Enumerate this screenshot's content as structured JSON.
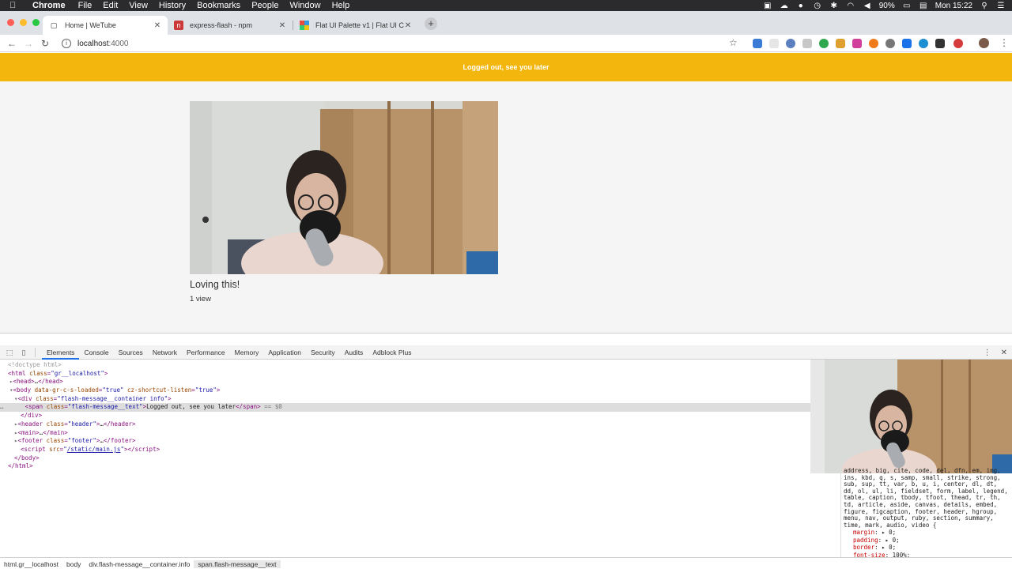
{
  "menubar": {
    "app": "Chrome",
    "menus": [
      "File",
      "Edit",
      "View",
      "History",
      "Bookmarks",
      "People",
      "Window",
      "Help"
    ],
    "battery": "90%",
    "clock": "Mon 15:22"
  },
  "tabs": [
    {
      "title": "Home | WeTube",
      "favicon": "page-icon"
    },
    {
      "title": "express-flash - npm",
      "favicon": "npm-icon"
    },
    {
      "title": "Flat UI Palette v1 | Flat UI C",
      "favicon": "palette-icon"
    }
  ],
  "address": {
    "host": "localhost",
    "port": ":4000"
  },
  "page": {
    "flash_message": "Logged out, see you later",
    "video": {
      "title": "Loving this!",
      "views": "1 view"
    }
  },
  "devtools": {
    "tabs": [
      "Elements",
      "Console",
      "Sources",
      "Network",
      "Performance",
      "Memory",
      "Application",
      "Security",
      "Audits",
      "Adblock Plus"
    ],
    "styles_selector": "address, big, cite, code, del, dfn, em, img, ins, kbd, q, s, samp, small, strike, strong, sub, sup, tt, var, b, u, i, center, dl, dt, dd, ol, ul, li, fieldset, form, label, legend, table, caption, tbody, tfoot, thead, tr, th, td, article, aside, canvas, details, embed, figure, figcaption, footer, header, hgroup, menu, nav, output, ruby, section, summary, time, mark, audio, video {",
    "styles_props": [
      {
        "name": "margin",
        "value": "▸ 0;"
      },
      {
        "name": "padding",
        "value": "▸ 0;"
      },
      {
        "name": "border",
        "value": "▸ 0;"
      },
      {
        "name": "font-size",
        "value": "100%;"
      }
    ],
    "breadcrumbs": [
      "html.gr__localhost",
      "body",
      "div.flash-message__container.info",
      "span.flash-message__text"
    ]
  },
  "colors": {
    "flash_bg": "#f3b60d",
    "page_bg": "#f5f5f5",
    "tab_strip": "#dee1e6"
  }
}
